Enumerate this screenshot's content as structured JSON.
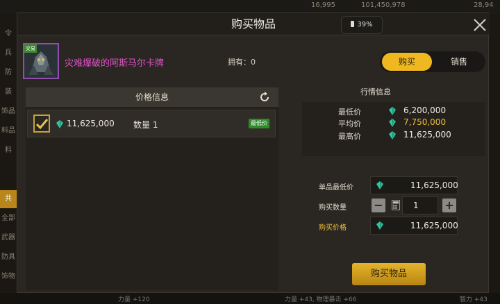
{
  "topbar": {
    "stat1": "16,995",
    "stat2": "101,450,978",
    "stat3": "28,94"
  },
  "leftnav": {
    "items": [
      "令",
      "兵",
      "防",
      "装",
      "饰品",
      "料品",
      "料",
      "共",
      "全部",
      "武器",
      "防具",
      "饰物"
    ]
  },
  "bottom_text": {
    "a": "力量 +120",
    "b": "力量 +43, 物理暴击 +66",
    "c": "智力 +43"
  },
  "modal": {
    "title": "购买物品",
    "battery": "39%",
    "item": {
      "name": "灾难爆破的阿斯马尔卡牌",
      "tag": "交易",
      "owned": "拥有：0"
    },
    "toggle": {
      "buy": "购买",
      "sell": "销售"
    },
    "price_info": {
      "title": "价格信息",
      "rows": [
        {
          "price": "11,625,000",
          "qty": "数量 1",
          "badge": "最低价"
        }
      ]
    },
    "market": {
      "title": "行情信息",
      "rows": [
        {
          "label": "最低价",
          "value": "6,200,000"
        },
        {
          "label": "平均价",
          "value": "7,750,000"
        },
        {
          "label": "最高价",
          "value": "11,625,000"
        }
      ]
    },
    "form": {
      "unit_low_label": "单品最低价",
      "unit_low_value": "11,625,000",
      "qty_label": "购买数量",
      "qty_value": "1",
      "total_label": "购买价格",
      "total_value": "11,625,000",
      "minus": "−",
      "plus": "+"
    },
    "buy_button": "购买物品"
  },
  "colors": {
    "accent": "#f0b820",
    "item_name": "#e052c8",
    "gem": "#2fc6a0",
    "avg_price": "#f1bf37"
  }
}
